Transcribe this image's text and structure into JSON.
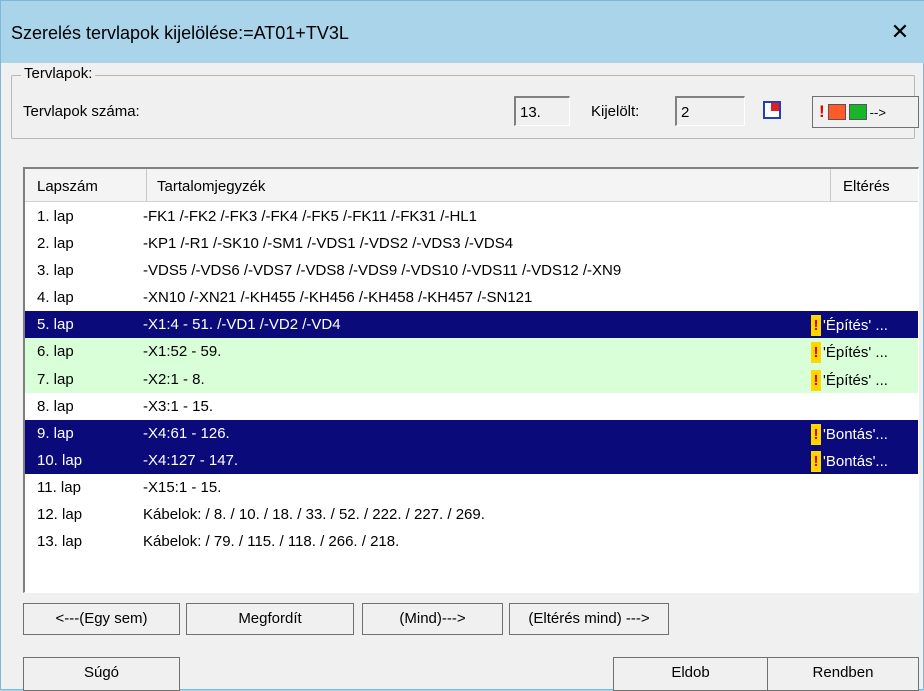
{
  "window": {
    "title": "Szerelés tervlapok kijelölése:=AT01+TV3L",
    "close_glyph": "✕"
  },
  "group": {
    "label": "Tervlapok:",
    "count_label": "Tervlapok száma:",
    "count_value": "13.",
    "selected_label": "Kijelölt:",
    "selected_value": "2",
    "diff_arrow": "-->"
  },
  "list": {
    "columns": [
      "Lapszám",
      "Tartalomjegyzék",
      "Eltérés"
    ],
    "rows": [
      {
        "page": "1. lap",
        "content": "-FK1 /-FK2 /-FK3 /-FK4 /-FK5 /-FK11 /-FK31 /-HL1",
        "diff": "",
        "state": "normal"
      },
      {
        "page": "2. lap",
        "content": "-KP1 /-R1 /-SK10 /-SM1 /-VDS1 /-VDS2 /-VDS3 /-VDS4",
        "diff": "",
        "state": "normal"
      },
      {
        "page": "3. lap",
        "content": "-VDS5 /-VDS6 /-VDS7 /-VDS8 /-VDS9 /-VDS10 /-VDS11 /-VDS12 /-XN9",
        "diff": "",
        "state": "normal"
      },
      {
        "page": "4. lap",
        "content": "-XN10 /-XN21 /-KH455 /-KH456 /-KH458 /-KH457 /-SN121",
        "diff": "",
        "state": "normal"
      },
      {
        "page": "5. lap",
        "content": "-X1:4 - 51. /-VD1 /-VD2 /-VD4",
        "diff": "'Építés' ...",
        "state": "selected"
      },
      {
        "page": "6. lap",
        "content": "-X1:52 - 59.",
        "diff": "'Építés' ...",
        "state": "marked"
      },
      {
        "page": "7. lap",
        "content": "-X2:1 - 8.",
        "diff": "'Építés' ...",
        "state": "marked"
      },
      {
        "page": "8. lap",
        "content": "-X3:1 - 15.",
        "diff": "",
        "state": "normal"
      },
      {
        "page": "9. lap",
        "content": "-X4:61 - 126.",
        "diff": "'Bontás'...",
        "state": "selected"
      },
      {
        "page": "10. lap",
        "content": "-X4:127 - 147.",
        "diff": "'Bontás'...",
        "state": "selected"
      },
      {
        "page": "11. lap",
        "content": "-X15:1 - 15.",
        "diff": "",
        "state": "normal"
      },
      {
        "page": "12. lap",
        "content": "Kábelok: / 8. / 10. / 18. / 33. / 52. / 222. / 227. / 269.",
        "diff": "",
        "state": "normal"
      },
      {
        "page": "13. lap",
        "content": "Kábelok: / 79. / 115. / 118. / 266. / 218.",
        "diff": "",
        "state": "normal"
      }
    ]
  },
  "buttons": {
    "none": "<---(Egy sem)",
    "invert": "Megfordít",
    "all": "(Mind)--->",
    "diff_all": "(Eltérés mind) --->",
    "help": "Súgó",
    "discard": "Eldob",
    "ok": "Rendben"
  },
  "colors": {
    "selection": "#0a0a7a",
    "marked": "#d8ffd8",
    "warning": "#ffd600",
    "title_bg": "#a9d4ea"
  }
}
